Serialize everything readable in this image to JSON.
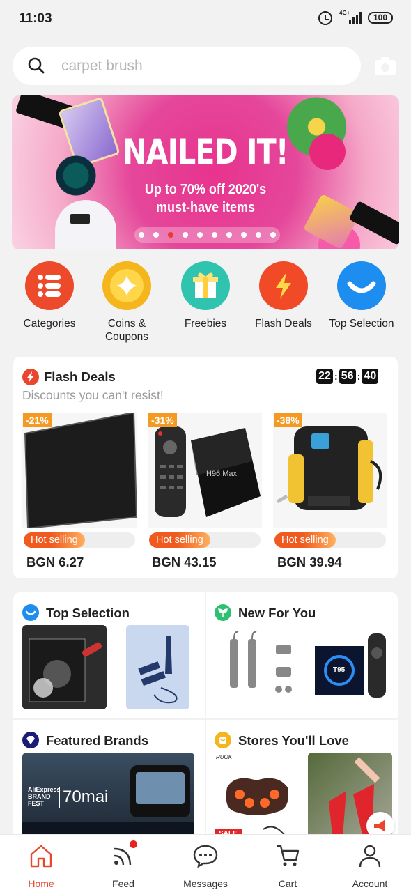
{
  "status_bar": {
    "time": "11:03",
    "network": "4G+",
    "battery": "100"
  },
  "search": {
    "placeholder": "carpet brush"
  },
  "banner": {
    "headline": "NAILED IT!",
    "subline_1": "Up to 70% off 2020's",
    "subline_2": "must-have items",
    "dot_count": 10,
    "active_dot": 2
  },
  "quick_links": [
    {
      "label": "Categories",
      "icon": "categories-icon",
      "color": "#ec4a2a"
    },
    {
      "label": "Coins &\nCoupons",
      "icon": "coins-icon",
      "color": "#f5b51c"
    },
    {
      "label": "Freebies",
      "icon": "gift-icon",
      "color": "#2fc3b0"
    },
    {
      "label": "Flash Deals",
      "icon": "flash-icon",
      "color": "#f04b26"
    },
    {
      "label": "Top Selection",
      "icon": "smile-icon",
      "color": "#1d8ef0"
    }
  ],
  "flash_deals": {
    "title": "Flash Deals",
    "subtitle": "Discounts you can't resist!",
    "timer": {
      "h": "22",
      "m": "56",
      "s": "40"
    },
    "products": [
      {
        "discount": "-21%",
        "tag": "Hot selling",
        "price": "BGN 6.27"
      },
      {
        "discount": "-31%",
        "tag": "Hot selling",
        "price": "BGN 43.15",
        "label_on_image": "H96 Max"
      },
      {
        "discount": "-38%",
        "tag": "Hot selling",
        "price": "BGN 39.94"
      }
    ]
  },
  "sections": {
    "top_selection": "Top Selection",
    "new_for_you": "New For You",
    "featured_brands": "Featured Brands",
    "stores": "Stores You'll Love",
    "brand_fest_1": "AliExpress",
    "brand_fest_2": "BRAND",
    "brand_fest_3": "FEST",
    "brand_name": "70mai",
    "store_tag": "SALE",
    "store_logo": "RUOK",
    "t95_label": "T95"
  },
  "nav": [
    {
      "label": "Home",
      "icon": "home-icon"
    },
    {
      "label": "Feed",
      "icon": "feed-icon"
    },
    {
      "label": "Messages",
      "icon": "messages-icon"
    },
    {
      "label": "Cart",
      "icon": "cart-icon"
    },
    {
      "label": "Account",
      "icon": "account-icon"
    }
  ],
  "colors": {
    "accent": "#e8472d",
    "badge": "#f49a22"
  }
}
